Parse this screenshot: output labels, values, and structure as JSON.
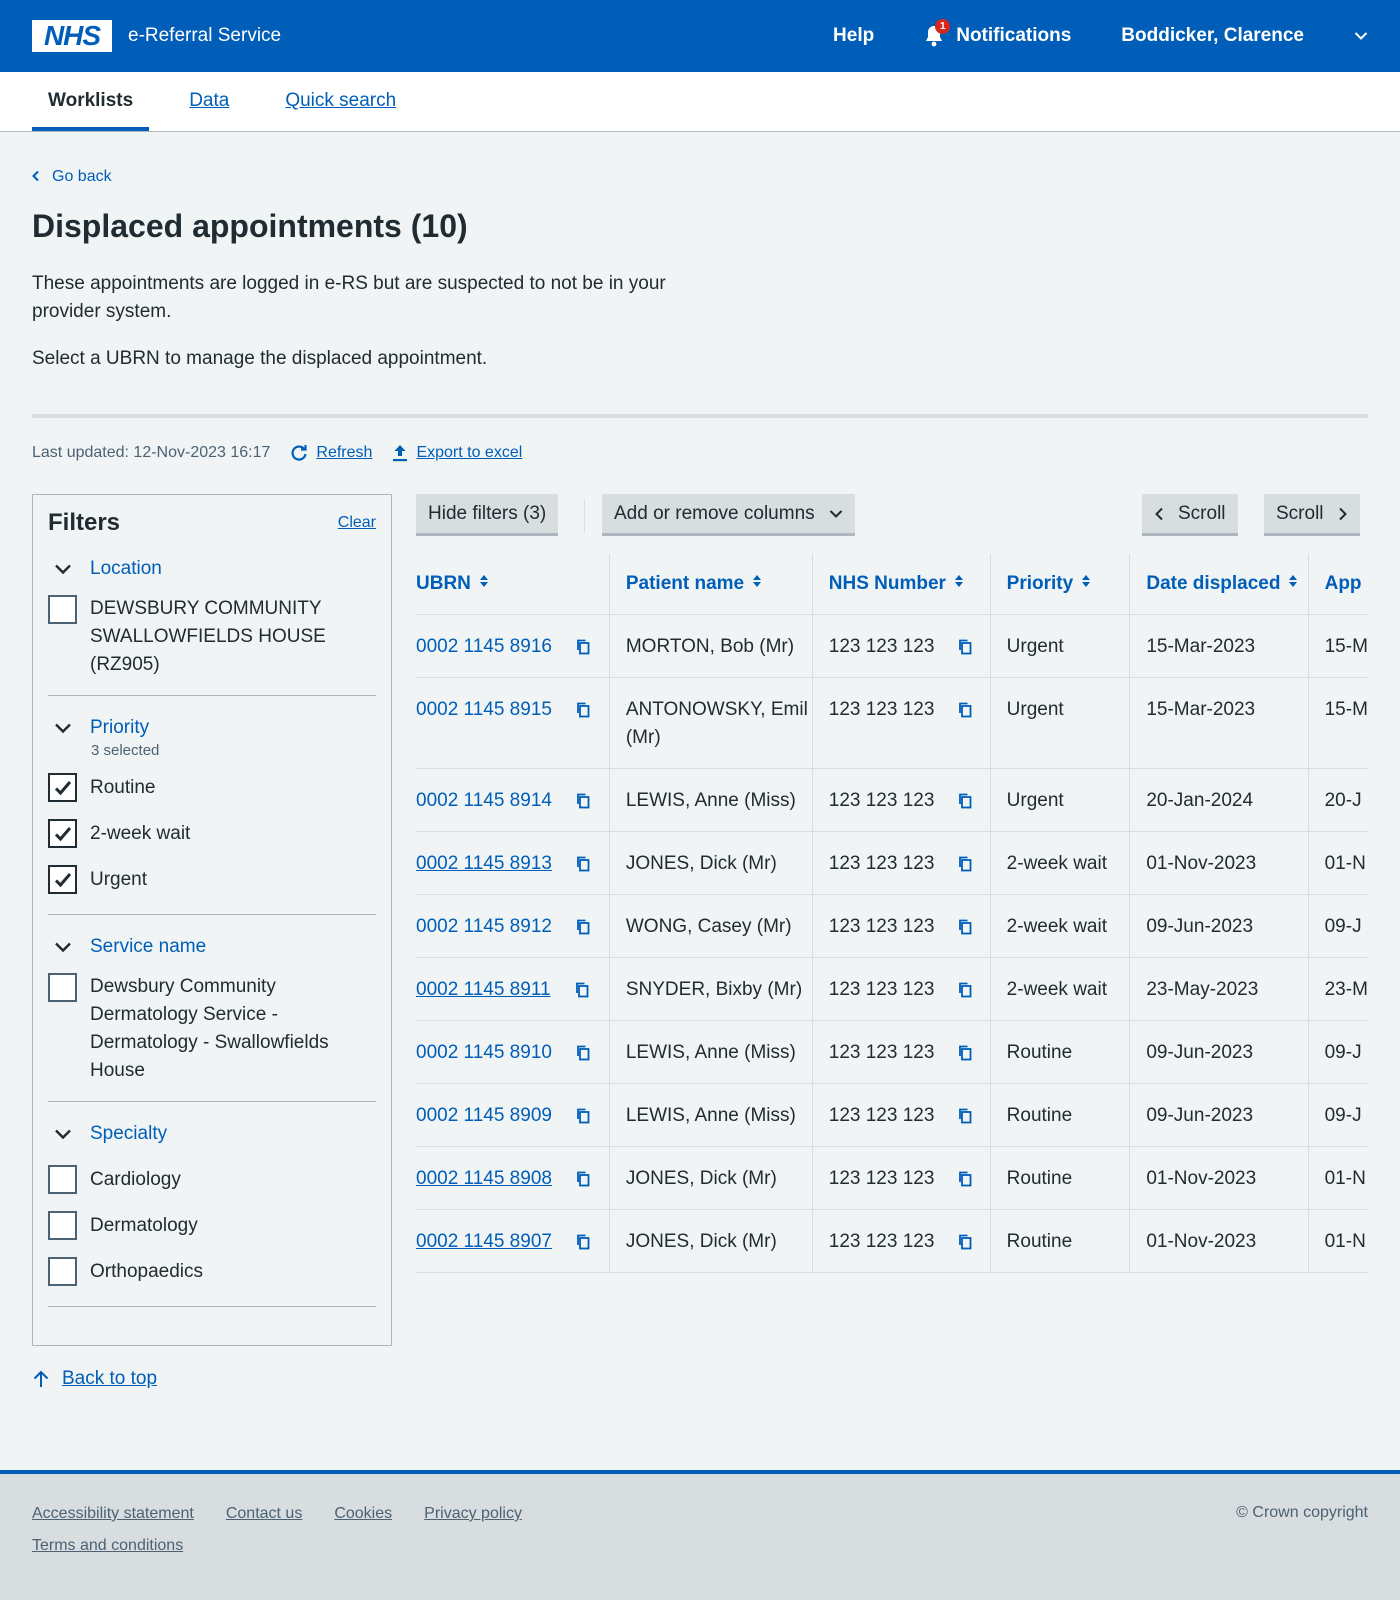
{
  "header": {
    "logo_text": "NHS",
    "service_name": "e-Referral Service",
    "help": "Help",
    "notifications": "Notifications",
    "notification_count": "1",
    "user": "Boddicker, Clarence",
    "colors": {
      "brand": "#005eb8",
      "badge": "#d5281b"
    }
  },
  "nav": {
    "tabs": [
      {
        "label": "Worklists",
        "active": true
      },
      {
        "label": "Data",
        "active": false
      },
      {
        "label": "Quick search",
        "active": false
      }
    ]
  },
  "page": {
    "back_label": "Go back",
    "title": "Displaced appointments (10)",
    "intro": "These appointments are logged in e-RS but are suspected to not be in your provider system.",
    "instruction": "Select a UBRN to manage the displaced appointment.",
    "last_updated": "Last updated: 12-Nov-2023 16:17",
    "refresh": "Refresh",
    "export": "Export to excel"
  },
  "filters": {
    "title": "Filters",
    "clear": "Clear",
    "location": {
      "heading": "Location",
      "options": [
        {
          "label": "DEWSBURY COMMUNITY SWALLOWFIELDS HOUSE (RZ905)",
          "checked": false
        }
      ]
    },
    "priority": {
      "heading": "Priority",
      "selected_text": "3 selected",
      "options": [
        {
          "label": "Routine",
          "checked": true
        },
        {
          "label": "2-week wait",
          "checked": true
        },
        {
          "label": "Urgent",
          "checked": true
        }
      ]
    },
    "service_name": {
      "heading": "Service name",
      "options": [
        {
          "label": "Dewsbury Community Dermatology Service - Dermatology - Swallowfields House",
          "checked": false
        }
      ]
    },
    "specialty": {
      "heading": "Specialty",
      "options": [
        {
          "label": "Cardiology",
          "checked": false
        },
        {
          "label": "Dermatology",
          "checked": false
        },
        {
          "label": "Orthopaedics",
          "checked": false
        }
      ]
    }
  },
  "toolbar": {
    "hide_filters": "Hide filters (3)",
    "columns": "Add or remove columns",
    "scroll_left": "Scroll",
    "scroll_right": "Scroll"
  },
  "table": {
    "headers": [
      "UBRN",
      "Patient name",
      "NHS Number",
      "Priority",
      "Date displaced",
      "App"
    ],
    "rows": [
      {
        "ubrn": "0002 1145 8916",
        "visited": false,
        "name": "MORTON, Bob (Mr)",
        "nhs": "123 123 123",
        "priority": "Urgent",
        "date": "15-Mar-2023",
        "app": "15-M"
      },
      {
        "ubrn": "0002 1145 8915",
        "visited": false,
        "name": "ANTONOWSKY, Emil (Mr)",
        "nhs": "123 123 123",
        "priority": "Urgent",
        "date": "15-Mar-2023",
        "app": "15-M"
      },
      {
        "ubrn": "0002 1145 8914",
        "visited": false,
        "name": "LEWIS, Anne (Miss)",
        "nhs": "123 123 123",
        "priority": "Urgent",
        "date": "20-Jan-2024",
        "app": "20-J"
      },
      {
        "ubrn": "0002 1145 8913",
        "visited": true,
        "name": "JONES, Dick (Mr)",
        "nhs": "123 123 123",
        "priority": "2-week wait",
        "date": "01-Nov-2023",
        "app": "01-N"
      },
      {
        "ubrn": "0002 1145 8912",
        "visited": false,
        "name": "WONG, Casey (Mr)",
        "nhs": "123 123 123",
        "priority": "2-week wait",
        "date": "09-Jun-2023",
        "app": "09-J"
      },
      {
        "ubrn": "0002 1145 8911",
        "visited": true,
        "name": "SNYDER, Bixby (Mr)",
        "nhs": "123 123 123",
        "priority": "2-week wait",
        "date": "23-May-2023",
        "app": "23-M"
      },
      {
        "ubrn": "0002 1145 8910",
        "visited": false,
        "name": "LEWIS, Anne (Miss)",
        "nhs": "123 123 123",
        "priority": "Routine",
        "date": "09-Jun-2023",
        "app": "09-J"
      },
      {
        "ubrn": "0002 1145 8909",
        "visited": false,
        "name": "LEWIS, Anne (Miss)",
        "nhs": "123 123 123",
        "priority": "Routine",
        "date": "09-Jun-2023",
        "app": "09-J"
      },
      {
        "ubrn": "0002 1145 8908",
        "visited": true,
        "name": "JONES, Dick (Mr)",
        "nhs": "123 123 123",
        "priority": "Routine",
        "date": "01-Nov-2023",
        "app": "01-N"
      },
      {
        "ubrn": "0002 1145 8907",
        "visited": true,
        "name": "JONES, Dick (Mr)",
        "nhs": "123 123 123",
        "priority": "Routine",
        "date": "01-Nov-2023",
        "app": "01-N"
      }
    ]
  },
  "back_to_top": "Back to top",
  "footer": {
    "links": [
      "Accessibility statement",
      "Contact us",
      "Cookies",
      "Privacy policy",
      "Terms and conditions"
    ],
    "copyright": "© Crown copyright"
  }
}
